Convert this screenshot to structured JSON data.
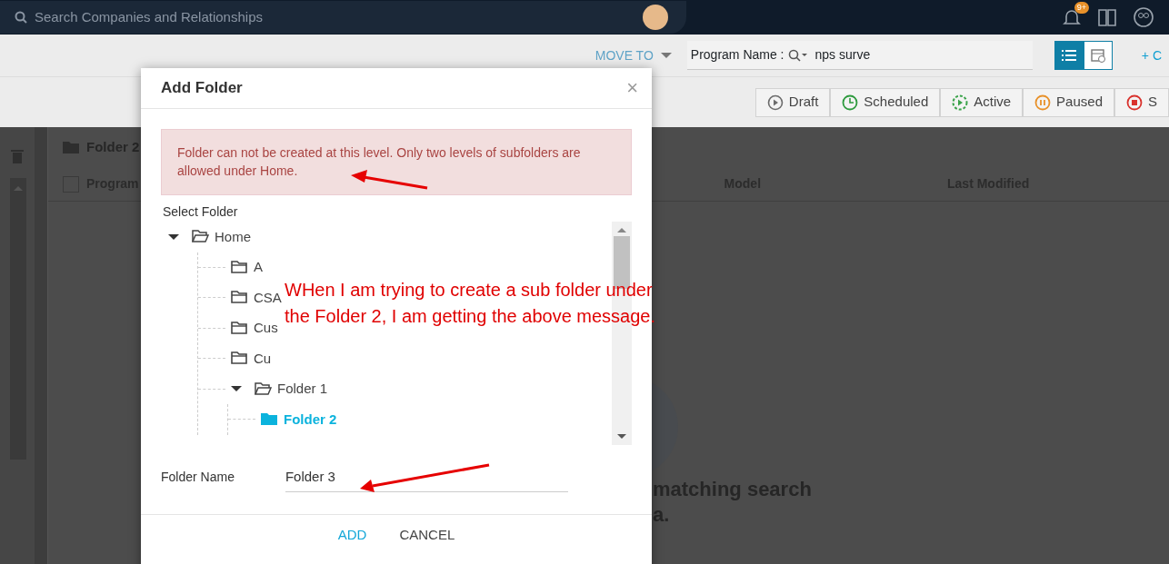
{
  "header": {
    "search": {
      "placeholder": "Search Companies and Relationships"
    },
    "notification_badge": "9+"
  },
  "toolbar": {
    "move_to": "MOVE TO",
    "program_name_label": "Program Name :",
    "program_name_value": "nps surve",
    "views": [
      {
        "kind": "list",
        "selected": true
      },
      {
        "kind": "calendar",
        "selected": false
      }
    ],
    "add_link": "+ C"
  },
  "status_filters": [
    {
      "kind": "draft",
      "label": "Draft",
      "color": "#6b6b6b"
    },
    {
      "kind": "scheduled",
      "label": "Scheduled",
      "color": "#2e9a3e"
    },
    {
      "kind": "active",
      "label": "Active",
      "color": "#3aa34a"
    },
    {
      "kind": "paused",
      "label": "Paused",
      "color": "#e8912a"
    },
    {
      "kind": "stopped",
      "label": "S",
      "color": "#d9322d"
    }
  ],
  "panel": {
    "folder_title": "Folder 2",
    "select_all_checked": false,
    "columns": [
      "Program",
      "Model",
      "Last Modified"
    ],
    "empty_message": [
      "matching search",
      "a."
    ]
  },
  "dialog": {
    "title": "Add Folder",
    "close": "×",
    "alert": "Folder can not be created at this level. Only two levels of subfolders are allowed under Home.",
    "select_label": "Select Folder",
    "tree": [
      {
        "label": "Home",
        "expanded": true,
        "selected": false,
        "children": [
          {
            "label": "A",
            "selected": false
          },
          {
            "label": "CSA",
            "selected": false
          },
          {
            "label": "Cus",
            "selected": false
          },
          {
            "label": "Cu",
            "selected": false
          },
          {
            "label": "Folder 1",
            "expanded": true,
            "selected": false,
            "children": [
              {
                "label": "Folder 2",
                "selected": true
              }
            ]
          }
        ]
      }
    ],
    "folder_name_label": "Folder Name",
    "folder_name_value": "Folder 3",
    "buttons": [
      "ADD",
      "CANCEL"
    ]
  },
  "annotation": {
    "text": "WHen I am trying to create a sub folder under the Folder 2, I am getting the above message."
  }
}
